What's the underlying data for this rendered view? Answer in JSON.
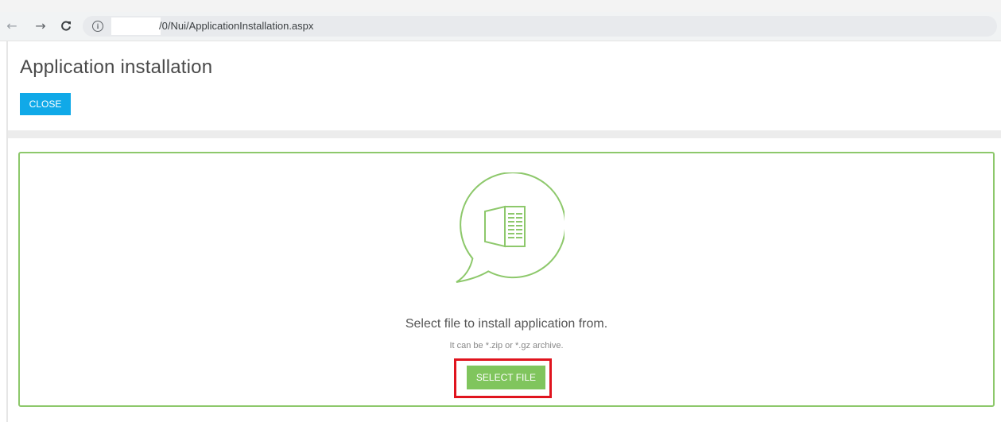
{
  "browser": {
    "back_icon": "back-arrow-icon",
    "forward_icon": "forward-arrow-icon",
    "reload_icon": "reload-icon",
    "info_icon": "info-icon",
    "url": "/0/Nui/ApplicationInstallation.aspx"
  },
  "header": {
    "title": "Application installation",
    "close_label": "CLOSE"
  },
  "dropzone": {
    "icon": "file-chat-bubble-icon",
    "message": "Select file to install application from.",
    "hint": "It can be *.zip or *.gz archive.",
    "select_label": "SELECT FILE"
  },
  "colors": {
    "close_button": "#10a9e8",
    "select_button": "#80c55d",
    "dropzone_border": "#8dc86b",
    "highlight": "#e0141e"
  }
}
